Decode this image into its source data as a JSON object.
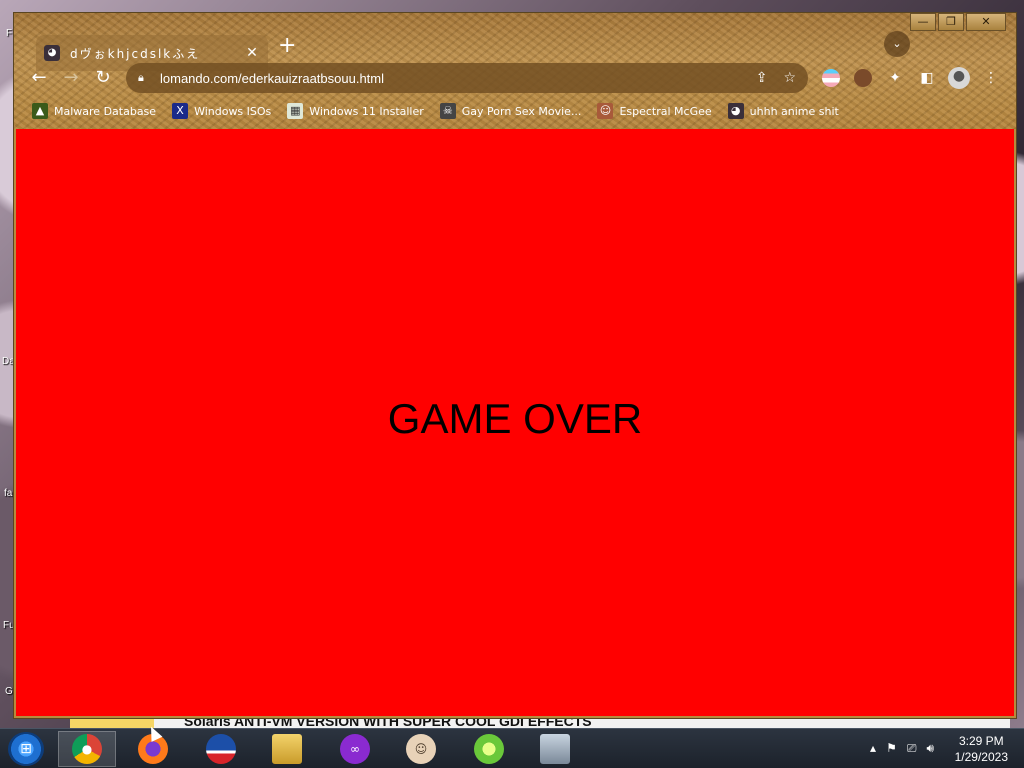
{
  "desktop": {
    "labels": [
      "F",
      "Da",
      "fa",
      "Fu",
      "G"
    ],
    "behind_window_text": "Solaris ANTI-VM VERSION WITH SUPER COOL GDI EFFECTS"
  },
  "browser": {
    "tab": {
      "title": "dヴぉkhjcdslkふえ",
      "favicon": "anime-avatar-icon"
    },
    "url": "lomando.com/ederkauizraatbsouu.html",
    "bookmarks": [
      {
        "label": "Malware Database",
        "icon": "malware-database-icon"
      },
      {
        "label": "Windows ISOs",
        "icon": "x-icon"
      },
      {
        "label": "Windows 11 Installer",
        "icon": "installer-icon"
      },
      {
        "label": "Gay Porn Sex Movie...",
        "icon": "skull-icon"
      },
      {
        "label": "Espectral McGee",
        "icon": "face-icon"
      },
      {
        "label": "uhhh anime shit",
        "icon": "anime-icon"
      }
    ],
    "theme_color": "#b88a3c"
  },
  "page": {
    "background": "#ff0000",
    "message": "GAME OVER"
  },
  "taskbar": {
    "apps": [
      {
        "name": "chrome",
        "active": true
      },
      {
        "name": "firefox",
        "active": false
      },
      {
        "name": "obama-logo",
        "active": false
      },
      {
        "name": "file-explorer",
        "active": false
      },
      {
        "name": "purple-mask-app",
        "active": false
      },
      {
        "name": "user-app",
        "active": false
      },
      {
        "name": "green-app",
        "active": false
      },
      {
        "name": "system-monitor",
        "active": false
      }
    ],
    "clock": {
      "time": "3:29 PM",
      "date": "1/29/2023"
    }
  }
}
